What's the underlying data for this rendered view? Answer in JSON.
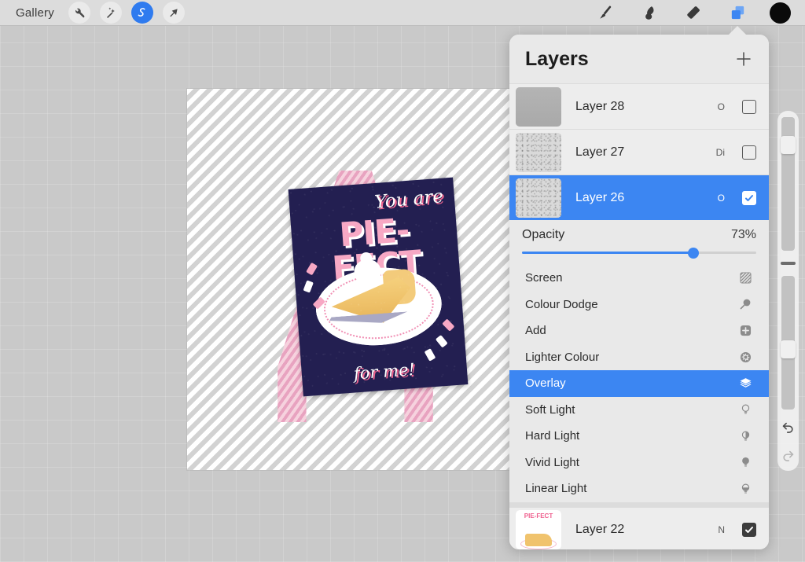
{
  "toolbar": {
    "gallery_label": "Gallery",
    "left_tools": [
      {
        "name": "adjustments-wrench-icon",
        "label": "Adjustments",
        "active": false
      },
      {
        "name": "magic-wand-icon",
        "label": "Adjustments Effects",
        "active": false
      },
      {
        "name": "selection-icon",
        "label": "Selection",
        "active": true
      },
      {
        "name": "transform-arrow-icon",
        "label": "Transform",
        "active": false
      }
    ],
    "right_tools": [
      {
        "name": "paintbrush-icon",
        "label": "Paint",
        "active": false
      },
      {
        "name": "smudge-icon",
        "label": "Smudge",
        "active": false
      },
      {
        "name": "eraser-icon",
        "label": "Erase",
        "active": false
      },
      {
        "name": "layers-icon",
        "label": "Layers",
        "active": true
      }
    ],
    "color_swatch": "#0a0a0a"
  },
  "sidebar": {
    "brush_size_label": "Brush Size",
    "brush_size_knob_pct": 12,
    "modify_label": "Modify",
    "brush_opacity_label": "Brush Opacity",
    "brush_opacity_knob_pct": 46,
    "undo_label": "Undo",
    "redo_label": "Redo"
  },
  "canvas": {
    "artwork_title": "You are PIE-FECT for me!",
    "line1": "You are",
    "line2": "PIE-FECT",
    "line3": "for  me!",
    "card_color": "#231f51",
    "accent_pink": "#f0648f",
    "easel_pink": "#e8a3c0"
  },
  "panel": {
    "title": "Layers",
    "add_label": "+",
    "layers": [
      {
        "name": "Layer 28",
        "mode": "O",
        "visible": false,
        "selected": false,
        "thumb": "solid"
      },
      {
        "name": "Layer 27",
        "mode": "Di",
        "visible": false,
        "selected": false,
        "thumb": "noise"
      },
      {
        "name": "Layer 26",
        "mode": "O",
        "visible": true,
        "selected": true,
        "thumb": "noise"
      }
    ],
    "bottom_layer": {
      "name": "Layer 22",
      "mode": "N",
      "visible": true,
      "selected": false,
      "thumb": "art"
    },
    "opacity": {
      "label": "Opacity",
      "value": "73%",
      "percent": 73
    },
    "blend_modes": [
      {
        "label": "Screen",
        "icon": "hatched-square-icon",
        "selected": false
      },
      {
        "label": "Colour Dodge",
        "icon": "magnifier-icon",
        "selected": false
      },
      {
        "label": "Add",
        "icon": "plus-square-icon",
        "selected": false
      },
      {
        "label": "Lighter Colour",
        "icon": "starburst-circle-icon",
        "selected": false
      },
      {
        "label": "Overlay",
        "icon": "stacked-layers-icon",
        "selected": true
      },
      {
        "label": "Soft Light",
        "icon": "bulb-outline-icon",
        "selected": false
      },
      {
        "label": "Hard Light",
        "icon": "bulb-half-icon",
        "selected": false
      },
      {
        "label": "Vivid Light",
        "icon": "bulb-filled-icon",
        "selected": false
      },
      {
        "label": "Linear Light",
        "icon": "bulb-bottom-icon",
        "selected": false
      }
    ]
  },
  "colors": {
    "accent_blue": "#3c86f2",
    "panel_bg": "#e9e9e9",
    "toolbar_bg": "#dcdcdc",
    "workspace_bg": "#c9c9c9"
  }
}
